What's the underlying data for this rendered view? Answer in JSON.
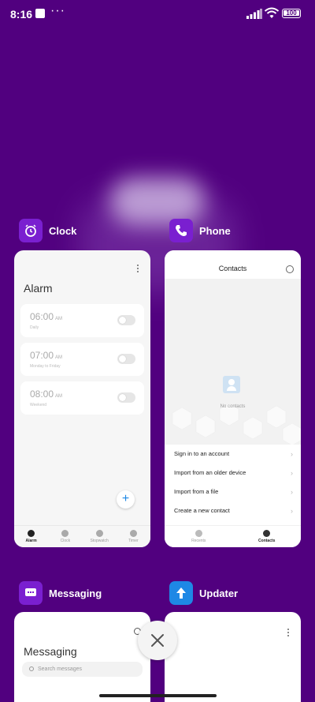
{
  "status_bar": {
    "time": "8:16",
    "more": "···",
    "battery": "100"
  },
  "apps": {
    "clock": {
      "name": "Clock",
      "screen_title": "Alarm",
      "alarms": [
        {
          "time": "06:00",
          "ampm": "AM",
          "sub": "Daily"
        },
        {
          "time": "07:00",
          "ampm": "AM",
          "sub": "Monday to Friday"
        },
        {
          "time": "08:00",
          "ampm": "AM",
          "sub": "Weekend"
        }
      ],
      "add_label": "+",
      "tabs": [
        "Alarm",
        "Clock",
        "Stopwatch",
        "Timer"
      ]
    },
    "phone": {
      "name": "Phone",
      "screen_title": "Contacts",
      "empty_text": "No contacts",
      "options": [
        "Sign in to an account",
        "Import from an older device",
        "Import from a file",
        "Create a new contact"
      ],
      "tabs": [
        "Recents",
        "Contacts"
      ]
    },
    "messaging": {
      "name": "Messaging",
      "screen_title": "Messaging",
      "search_placeholder": "Search messages"
    },
    "updater": {
      "name": "Updater"
    }
  },
  "colors": {
    "background": "#51007f",
    "clock_icon": "#7a1fd0",
    "updater_icon": "#1e88e5"
  }
}
